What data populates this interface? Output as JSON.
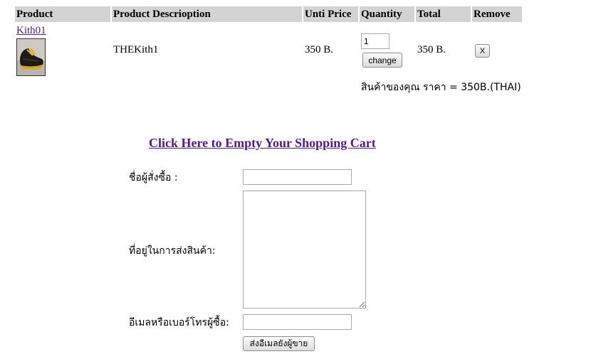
{
  "table": {
    "headers": {
      "product": "Product",
      "description": "Product Descrioption",
      "unit_price": "Unti Price",
      "quantity": "Quantity",
      "total": "Total",
      "remove": "Remove"
    },
    "rows": [
      {
        "product_link": "Kith01",
        "description": "THEKith1",
        "unit_price": "350 B.",
        "quantity": "1",
        "change_label": "change",
        "total": "350 B.",
        "remove_label": "X"
      }
    ],
    "summary": "สินค้าของคุณ ราคา = 350B.(THAI)"
  },
  "empty_cart_link": "Click Here to Empty Your Shopping Cart",
  "form": {
    "name_label": "ชื่อผู้สั่งซื้อ :",
    "name_value": "",
    "address_label": "ที่อยู่ในการส่งสินค้า:",
    "address_value": "",
    "contact_label": "อีเมลหรือเบอร์โทรผู้ซื้อ:",
    "contact_value": "",
    "submit_label": "ส่งอีเมลยังผู้ขาย"
  }
}
